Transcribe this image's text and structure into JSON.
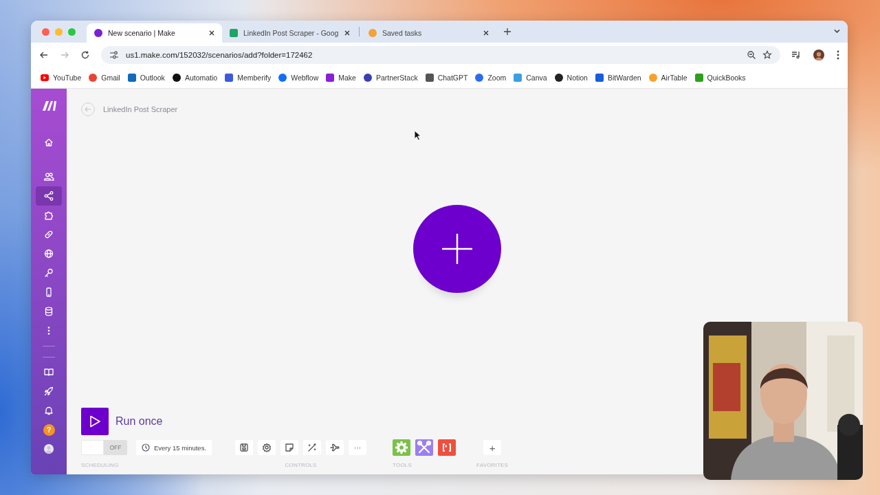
{
  "tabs": [
    {
      "title": "New scenario | Make",
      "selected": true,
      "color": "#7a1fd6"
    },
    {
      "title": "LinkedIn Post Scraper - Goog",
      "selected": false,
      "color": "#1fa463"
    },
    {
      "title": "Saved tasks",
      "selected": false,
      "color": "#f2a33a"
    }
  ],
  "nav": {
    "forward_disabled": true,
    "url": "us1.make.com/152032/scenarios/add?folder=172462"
  },
  "bookmarks": [
    {
      "label": "YouTube",
      "color": "#ff0000"
    },
    {
      "label": "Gmail",
      "color": "#ea4335"
    },
    {
      "label": "Outlook",
      "color": "#0f6cbd"
    },
    {
      "label": "Automatio",
      "color": "#111111"
    },
    {
      "label": "Memberify",
      "color": "#3b5bdb"
    },
    {
      "label": "Webflow",
      "color": "#146ef5"
    },
    {
      "label": "Make",
      "color": "#8a1fd6"
    },
    {
      "label": "PartnerStack",
      "color": "#3b3fb6"
    },
    {
      "label": "ChatGPT",
      "color": "#555555"
    },
    {
      "label": "Zoom",
      "color": "#2d6cf0"
    },
    {
      "label": "Canva",
      "color": "#3aa0e6"
    },
    {
      "label": "Notion",
      "color": "#222222"
    },
    {
      "label": "BitWarden",
      "color": "#175ddc"
    },
    {
      "label": "AirTable",
      "color": "#f8a12b"
    },
    {
      "label": "QuickBooks",
      "color": "#2ca01c"
    }
  ],
  "sidebar": {
    "items": [
      {
        "kind": "home",
        "selected": false
      },
      {
        "kind": "users",
        "selected": false
      },
      {
        "kind": "share",
        "selected": true
      },
      {
        "kind": "puzzle",
        "selected": false
      },
      {
        "kind": "link",
        "selected": false
      },
      {
        "kind": "globe",
        "selected": false
      },
      {
        "kind": "key",
        "selected": false
      },
      {
        "kind": "phone",
        "selected": false
      },
      {
        "kind": "database",
        "selected": false
      },
      {
        "kind": "more",
        "selected": false
      },
      {
        "kind": "divider"
      },
      {
        "kind": "divider"
      },
      {
        "kind": "book",
        "selected": false
      },
      {
        "kind": "rocket",
        "selected": false
      },
      {
        "kind": "bell",
        "selected": false
      },
      {
        "kind": "help",
        "label": "?",
        "selected": false
      },
      {
        "kind": "avatar",
        "selected": false
      }
    ]
  },
  "scenario": {
    "title": "LinkedIn Post Scraper"
  },
  "run_button": {
    "label": "Run once"
  },
  "scheduling": {
    "on": false,
    "state": "OFF",
    "interval": "Every 15 minutes.",
    "caption": "SCHEDULING"
  },
  "controls": {
    "items": [
      {
        "kind": "save"
      },
      {
        "kind": "settings"
      },
      {
        "kind": "note"
      },
      {
        "kind": "wand"
      },
      {
        "kind": "plane"
      },
      {
        "kind": "more",
        "label": "···"
      }
    ],
    "caption": "CONTROLS"
  },
  "tools": {
    "items": [
      {
        "kind": "gear",
        "color": "#7cc14a"
      },
      {
        "kind": "wrench",
        "color": "#9b7ff0"
      },
      {
        "kind": "brackets",
        "color": "#f04e3e"
      }
    ],
    "caption": "TOOLS"
  },
  "favorites": {
    "add": "+",
    "caption": "FAVORITES"
  }
}
